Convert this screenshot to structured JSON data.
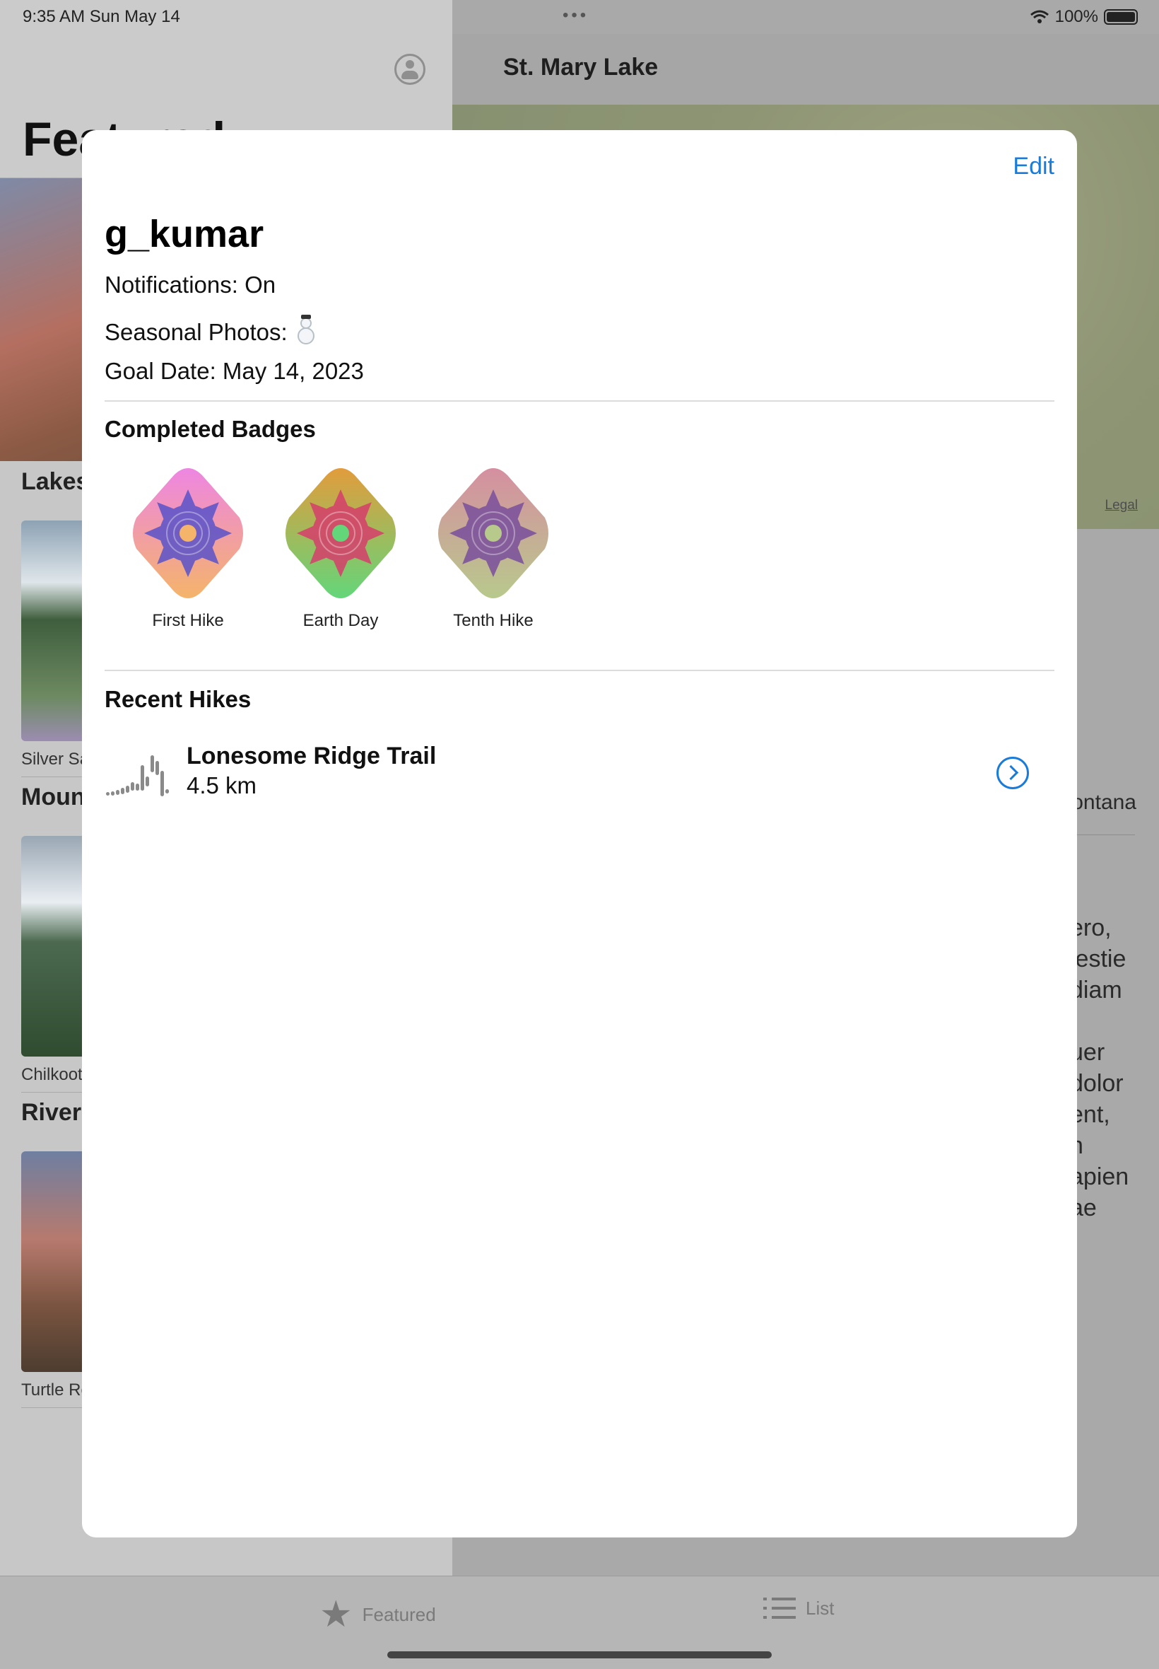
{
  "status_bar": {
    "time": "9:35 AM   Sun May 14",
    "battery": "100%"
  },
  "sidebar": {
    "title": "Featured",
    "categories": [
      {
        "title": "Lakes",
        "caption": "Silver Salmon Creek"
      },
      {
        "title": "Mountains",
        "caption": "Chilkoot Trail"
      },
      {
        "title": "Rivers",
        "caption": "Turtle Rock"
      }
    ]
  },
  "detail": {
    "title": "St. Mary Lake",
    "map_legal": "Legal",
    "subtitle_fragment": "ontana",
    "body_fragment": "ero,\nlestie\ndiam\n\nuer\ndolor\nent,\nn\napien\nae\nt"
  },
  "tab_bar": {
    "featured_label": "Featured",
    "list_label": "List"
  },
  "profile": {
    "edit_label": "Edit",
    "username": "g_kumar",
    "notifications": "Notifications: On",
    "seasonal_label": "Seasonal Photos:",
    "seasonal_icon": "snowman-icon",
    "goal_date": "Goal Date: May 14, 2023",
    "badges_title": "Completed Badges",
    "badges": [
      {
        "label": "First Hike",
        "top": "#ee86e2",
        "bottom": "#f4b46a",
        "inner": "#5a53c9"
      },
      {
        "label": "Earth Day",
        "top": "#e29c3c",
        "bottom": "#63d67a",
        "inner": "#d63e6c"
      },
      {
        "label": "Tenth Hike",
        "top": "#d58fa0",
        "bottom": "#b8c98c",
        "inner": "#7a4f9c"
      }
    ],
    "recent_title": "Recent Hikes",
    "hike": {
      "name": "Lonesome Ridge Trail",
      "distance": "4.5 km"
    }
  },
  "colors": {
    "accent": "#1a7bd8"
  }
}
